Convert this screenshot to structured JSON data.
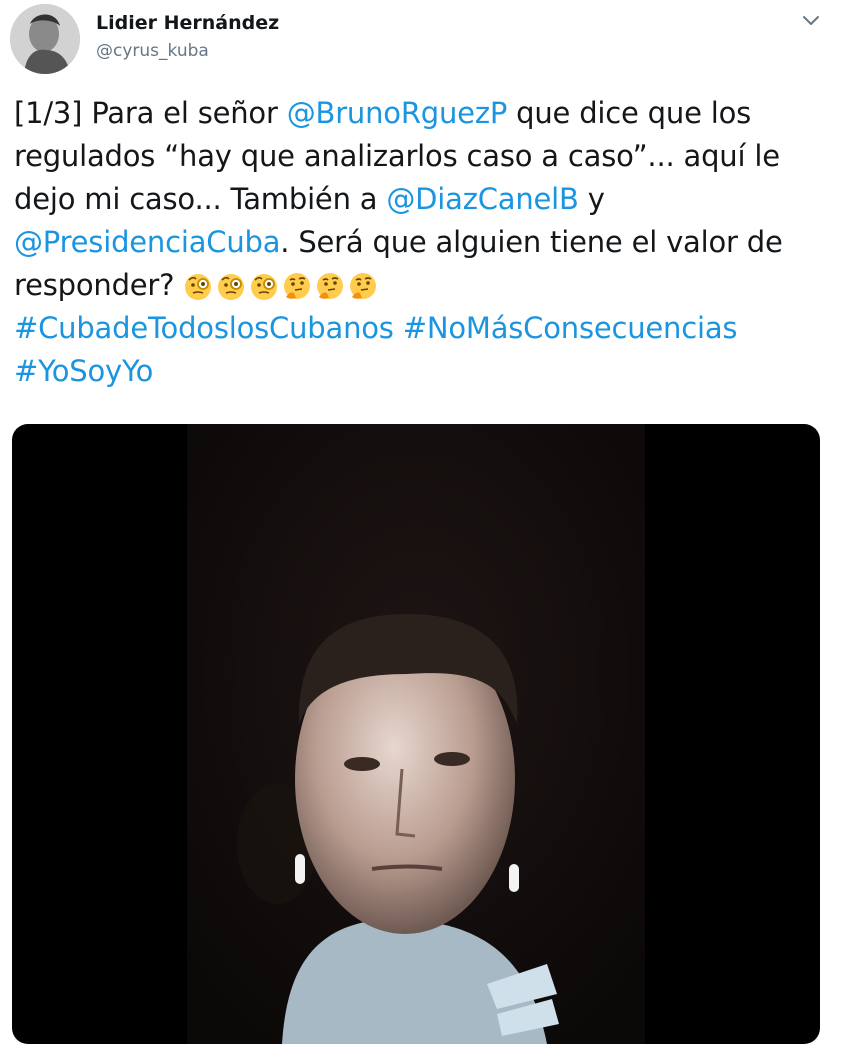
{
  "author": {
    "display_name": "Lidier Hernández",
    "handle": "@cyrus_kuba"
  },
  "menu": {
    "icon": "chevron-down-icon"
  },
  "tweet": {
    "line1": {
      "t1": "[1/3] Para el señor ",
      "m1": "@BrunoRguezP",
      "t2": " que dice que los"
    },
    "line2": {
      "t1": "regulados “hay que analizarlos caso a caso”... aquí le"
    },
    "line3": {
      "t1": "dejo mi caso... También a ",
      "m1": "@DiazCanelB",
      "t2": " y"
    },
    "line4": {
      "m1": "@PresidenciaCuba",
      "t1": ". Será que alguien tiene el valor de"
    },
    "line5": {
      "t1": "responder? "
    },
    "emojis": [
      "face-with-monocle",
      "face-with-monocle",
      "face-with-monocle",
      "thinking-face",
      "thinking-face",
      "thinking-face"
    ],
    "hashtags": {
      "h1": "#CubadeTodoslosCubanos",
      "h2": "#NoMásConsecuencias",
      "h3": "#YoSoyYo"
    }
  },
  "media": {
    "type": "video",
    "icon": "video-thumbnail"
  },
  "colors": {
    "link": "#1b95e0",
    "text": "#14171a",
    "secondary": "#657786",
    "media_bg": "#000000"
  }
}
